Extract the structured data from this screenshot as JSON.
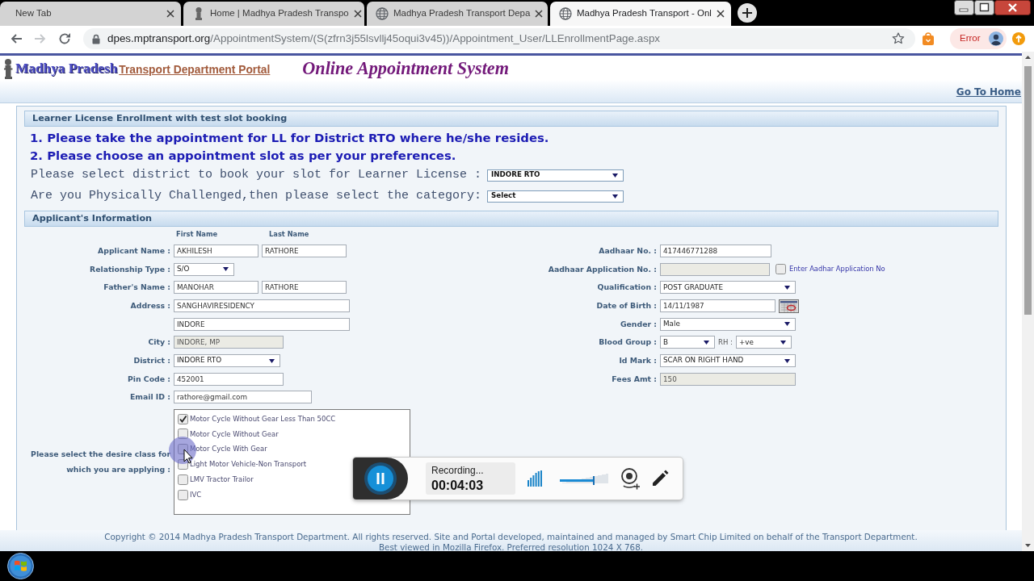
{
  "browser": {
    "tabs": [
      {
        "title": "New Tab",
        "selected": false
      },
      {
        "title": "Home | Madhya Pradesh Transpo",
        "selected": false
      },
      {
        "title": "Madhya Pradesh Transport Depa",
        "selected": false
      },
      {
        "title": "Madhya Pradesh Transport - Onl",
        "selected": true
      }
    ],
    "url": {
      "host": "dpes.mptransport.org",
      "path": "/AppointmentSystem/(S(zfrn3j55lsvllj45oqui3v45))/Appointment_User/LLEnrollmentPage.aspx"
    },
    "profile_label": "Error"
  },
  "header": {
    "logo_title": "Madhya Pradesh",
    "logo_subtitle": "Transport Department Portal",
    "app_title": "Online Appointment System",
    "home_link": "Go To Home"
  },
  "enrollment": {
    "heading": "Learner License Enrollment with test slot booking",
    "notices": [
      "1. Please take the appointment for LL for District RTO where he/she resides.",
      "2. Please choose an appointment slot as per your preferences."
    ],
    "choices": [
      {
        "label": "Please select district to book your slot for Learner License :",
        "value": "INDORE RTO"
      },
      {
        "label": "Are you Physically Challenged,then please select the category:",
        "value": "Select"
      }
    ]
  },
  "applicant": {
    "heading": "Applicant's Information",
    "column_headers": [
      "First Name",
      "Last Name"
    ],
    "left_fields": [
      {
        "kind": "pair",
        "label": "Applicant Name :",
        "values": [
          "AKHILESH",
          "RATHORE"
        ],
        "disabled": false
      },
      {
        "kind": "select",
        "label": "Relationship Type :",
        "value": "S/O",
        "disabled": false
      },
      {
        "kind": "pair",
        "label": "Father's Name :",
        "values": [
          "MANOHAR",
          "RATHORE"
        ],
        "disabled": false
      },
      {
        "kind": "text",
        "label": "Address :",
        "value": "SANGHAVIRESIDENCY",
        "disabled": false
      },
      {
        "kind": "text",
        "value": "INDORE",
        "disabled": false
      },
      {
        "kind": "text",
        "label": "City :",
        "value": "INDORE, MP",
        "disabled": true
      },
      {
        "kind": "select",
        "label": "District :",
        "value": "INDORE RTO",
        "disabled": false
      },
      {
        "kind": "text",
        "label": "Pin Code :",
        "value": "452001",
        "disabled": false
      },
      {
        "kind": "text",
        "label": "Email ID :",
        "value": "rathore@gmail.com",
        "disabled": false
      }
    ],
    "right_fields": [
      {
        "kind": "text",
        "label": "Aadhaar No. :",
        "value": "417446771288",
        "disabled": false
      },
      {
        "kind": "text_check",
        "label": "Aadhaar Application No. :",
        "disabled": true,
        "checked": false,
        "check_label": "Enter Aadhar Application No"
      },
      {
        "kind": "select",
        "label": "Qualification :",
        "value": "POST GRADUATE",
        "disabled": false
      },
      {
        "kind": "date",
        "label": "Date of Birth :",
        "value": "14/11/1987",
        "disabled": false
      },
      {
        "kind": "select",
        "label": "Gender :",
        "value": "Male",
        "disabled": false
      },
      {
        "kind": "blood",
        "label": "Blood Group :",
        "value": "B",
        "rh_label": "RH :",
        "rh_value": "+ve",
        "disabled": false
      },
      {
        "kind": "select",
        "label": "Id Mark :",
        "value": "SCAR ON RIGHT HAND",
        "disabled": false
      },
      {
        "kind": "text",
        "label": "Fees Amt :",
        "value": "150",
        "disabled": true
      }
    ],
    "class_label": "Please select the desire class for which you are applying :",
    "classes": [
      {
        "label": "Motor Cycle Without Gear Less Than 50CC",
        "checked": true
      },
      {
        "label": "Motor Cycle Without Gear",
        "checked": false
      },
      {
        "label": "Motor Cycle With Gear",
        "checked": false
      },
      {
        "label": "Light Motor Vehicle-Non Transport",
        "checked": false
      },
      {
        "label": "LMV Tractor Trailor",
        "checked": false
      },
      {
        "label": "IVC",
        "checked": false
      }
    ]
  },
  "recorder": {
    "status": "Recording...",
    "time": "00:04:03",
    "volume": {
      "level": 0.7
    }
  },
  "footer": {
    "lines": [
      "Copyright © 2014 Madhya Pradesh Transport Department. All rights reserved. Site and Portal developed, maintained and managed by Smart Chip Limited on behalf of the Transport Department.",
      "Best viewed in Mozilla Firefox. Preferred resolution 1024 X 768."
    ]
  }
}
